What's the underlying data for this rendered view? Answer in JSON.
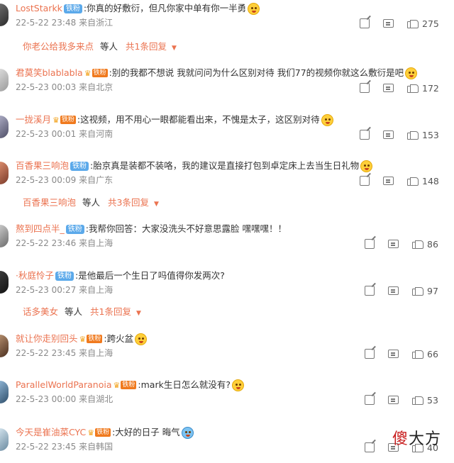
{
  "comments": [
    {
      "name": "LostStarkk",
      "badge": "铁粉",
      "badge_type": "fan",
      "text": ":你真的好敷衍，但凡你家中单有你一半勇",
      "emoji": "surprised-emoji",
      "date": "22-5-22 23:48",
      "location": "来自浙江",
      "likes": "275"
    },
    {
      "name": "君莫笑blablabla",
      "badge": "铁粉",
      "badge_type": "crown",
      "text": ":别的我都不想说 我就问问为什么区别对待 我们77的视频你就这么敷衍是吧",
      "emoji": "cry-emoji",
      "date": "22-5-23 00:03",
      "location": "来自北京",
      "likes": "172"
    },
    {
      "name": "一拢溪月",
      "badge": "铁粉",
      "badge_type": "crown",
      "text": ":这视频，用不用心一眼都能看出来，不愧是太子，这区别对待",
      "emoji": "cry-emoji",
      "date": "22-5-23 00:01",
      "location": "来自河南",
      "likes": "153"
    },
    {
      "name": "百香果三响泡",
      "badge": "铁粉",
      "badge_type": "fan",
      "text": ":胎京真是装都不装咯，我的建议是直接打包到卓定床上去当生日礼物",
      "emoji": "laugh-emoji",
      "date": "22-5-23 00:09",
      "location": "来自广东",
      "likes": "148"
    },
    {
      "name": "熬到四点半_",
      "badge": "铁粉",
      "badge_type": "fan",
      "text": ":我帮你回答：大家没洗头不好意思露脸 嘿嘿嘿！！",
      "emoji": "",
      "date": "22-5-22 23:46",
      "location": "来自上海",
      "likes": "86"
    },
    {
      "name": "·秋庭怜子",
      "badge": "铁粉",
      "badge_type": "fan",
      "text": ":是他最后一个生日了吗值得你发两次?",
      "emoji": "",
      "date": "22-5-23 00:27",
      "location": "来自上海",
      "likes": "97"
    },
    {
      "name": "就让你走别回头",
      "badge": "铁粉",
      "badge_type": "crown",
      "text": ":跨火盆",
      "emoji": "tongue-emoji",
      "date": "22-5-22 23:45",
      "location": "来自上海",
      "likes": "66"
    },
    {
      "name": "ParallelWorldParanoia",
      "badge": "铁粉",
      "badge_type": "crown",
      "text": ":mark生日怎么就没有?",
      "emoji": "surprised-emoji",
      "date": "22-5-23 00:00",
      "location": "来自湖北",
      "likes": "53"
    },
    {
      "name": "今天是崔油菜CYC",
      "badge": "铁粉",
      "badge_type": "crown",
      "text": ":大好的日子 晦气",
      "emoji": "mask-emoji",
      "date": "22-5-22 23:45",
      "location": "来自韩国",
      "likes": "40"
    }
  ],
  "replies": [
    {
      "name": "你老公给我多来点",
      "mid": "等人",
      "link": "共1条回复"
    },
    {
      "name": "百香果三响泡",
      "mid": "等人",
      "link": "共3条回复"
    },
    {
      "name": "话多美女",
      "mid": "等人",
      "link": "共1条回复"
    }
  ],
  "watermark": {
    "part1": "傻",
    "part2": "大方"
  }
}
